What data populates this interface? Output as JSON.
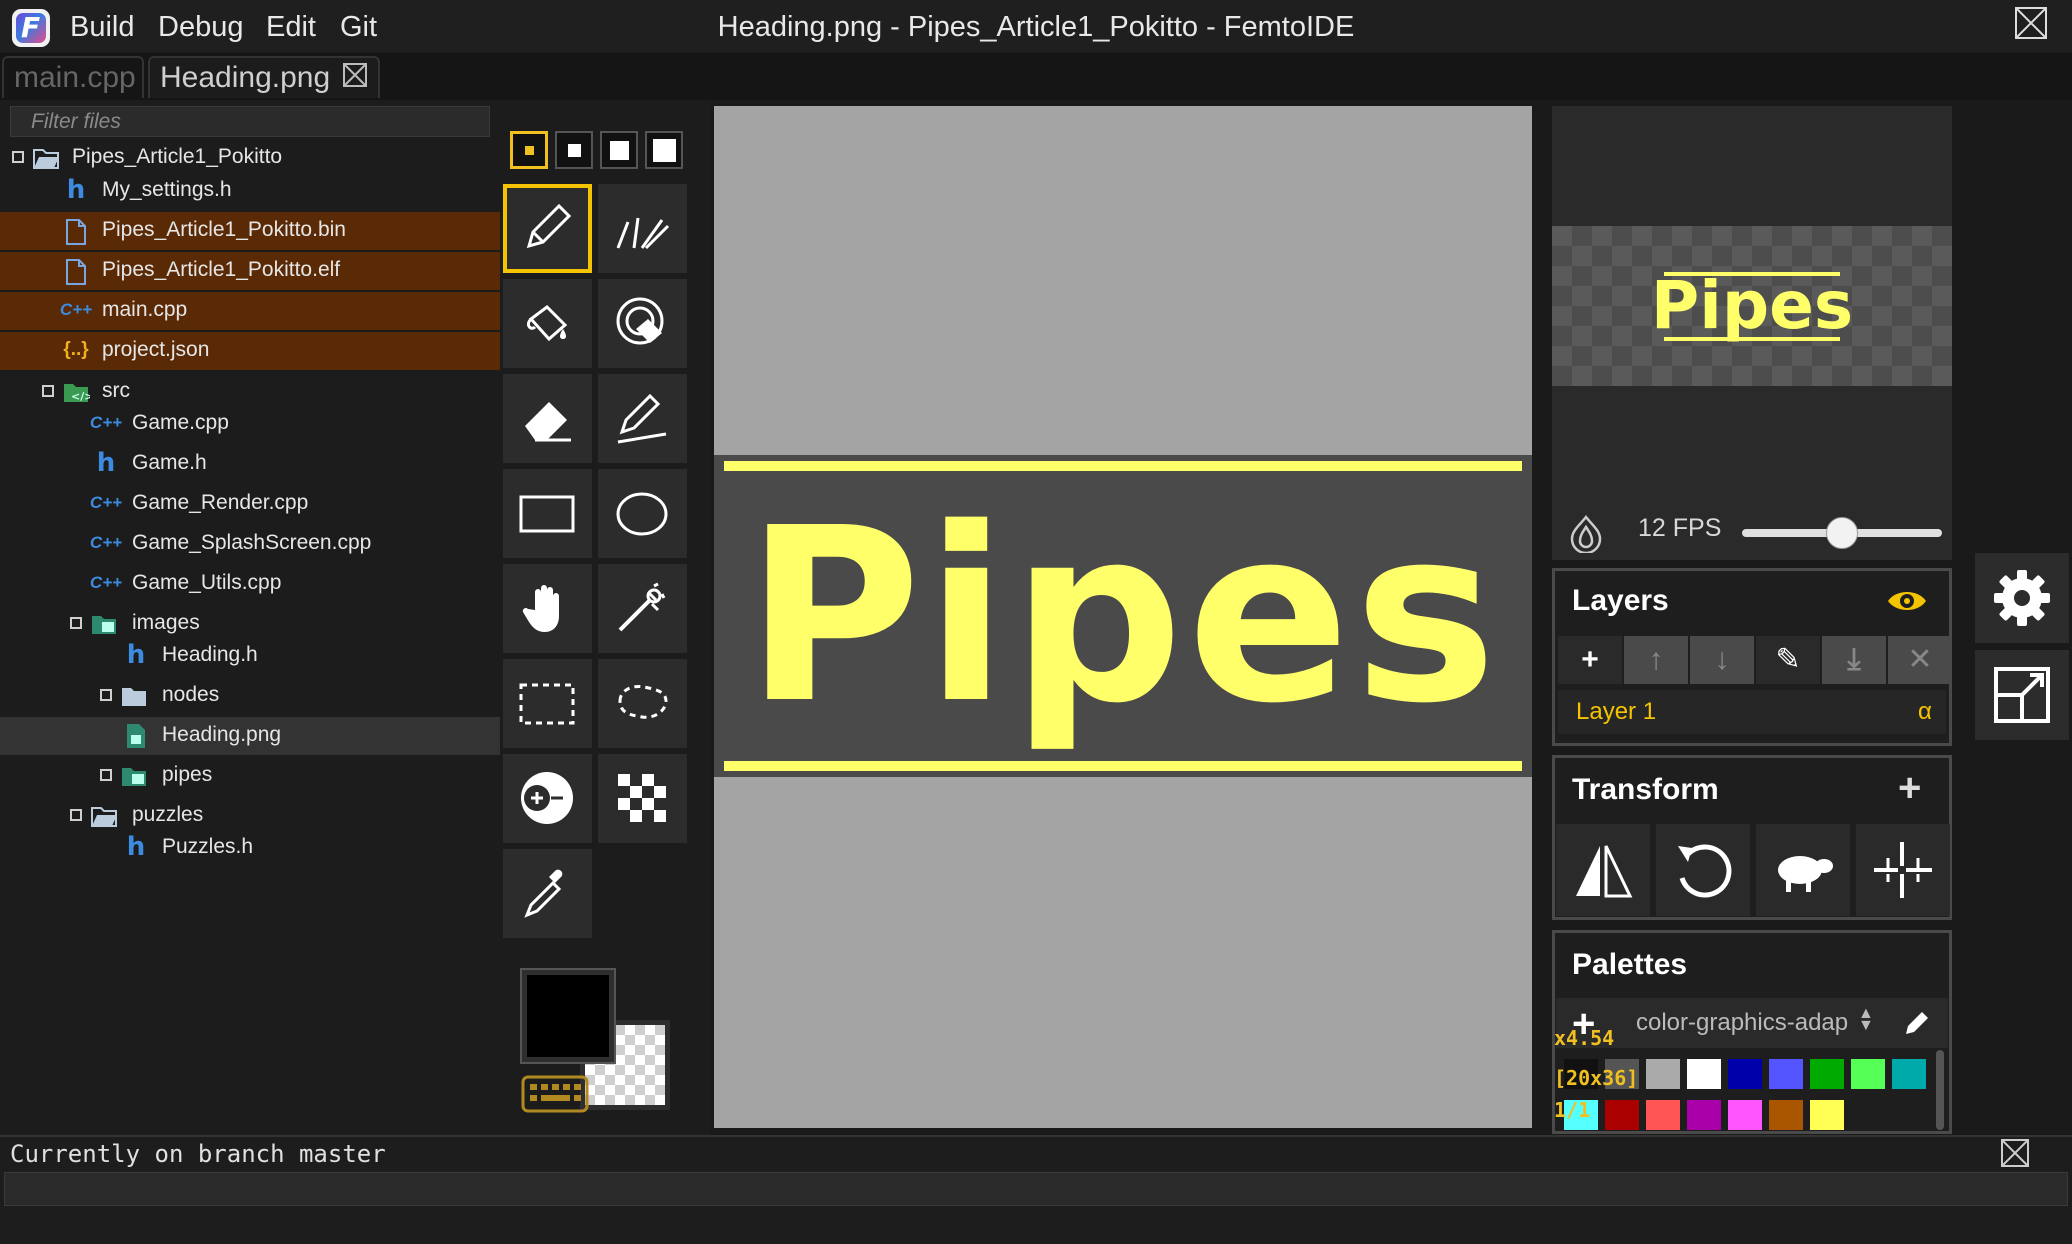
{
  "app": {
    "window_title": "Heading.png - Pipes_Article1_Pokitto - FemtoIDE",
    "menu": [
      "Build",
      "Debug",
      "Edit",
      "Git"
    ]
  },
  "tabs": [
    {
      "label": "main.cpp",
      "active": false
    },
    {
      "label": "Heading.png",
      "active": true
    }
  ],
  "filetree": {
    "filter_placeholder": "Filter files",
    "items": [
      {
        "label": "Pipes_Article1_Pokitto",
        "icon": "folder-open-icon"
      },
      {
        "label": "My_settings.h",
        "icon": "h-file-icon"
      },
      {
        "label": "Pipes_Article1_Pokitto.bin",
        "icon": "file-icon"
      },
      {
        "label": "Pipes_Article1_Pokitto.elf",
        "icon": "file-icon"
      },
      {
        "label": "main.cpp",
        "icon": "cpp-file-icon"
      },
      {
        "label": "project.json",
        "icon": "json-file-icon"
      },
      {
        "label": "src",
        "icon": "source-folder-icon"
      },
      {
        "label": "Game.cpp",
        "icon": "cpp-file-icon"
      },
      {
        "label": "Game.h",
        "icon": "h-file-icon"
      },
      {
        "label": "Game_Render.cpp",
        "icon": "cpp-file-icon"
      },
      {
        "label": "Game_SplashScreen.cpp",
        "icon": "cpp-file-icon"
      },
      {
        "label": "Game_Utils.cpp",
        "icon": "cpp-file-icon"
      },
      {
        "label": "images",
        "icon": "image-folder-icon"
      },
      {
        "label": "Heading.h",
        "icon": "h-file-icon"
      },
      {
        "label": "nodes",
        "icon": "folder-icon"
      },
      {
        "label": "Heading.png",
        "icon": "image-file-icon"
      },
      {
        "label": "pipes",
        "icon": "image-folder-icon"
      },
      {
        "label": "puzzles",
        "icon": "folder-open-icon"
      },
      {
        "label": "Puzzles.h",
        "icon": "h-file-icon"
      }
    ]
  },
  "icon_glyphs": {
    "h": "h",
    "cpp": "C++",
    "json": "{..}"
  },
  "canvas": {
    "image_text": "Pipes"
  },
  "preview": {
    "image_text": "Pipes",
    "fps_label": "12 FPS",
    "fps_slider_fraction": 0.5
  },
  "layers": {
    "title": "Layers",
    "layer_name": "Layer 1",
    "alpha_symbol": "α",
    "buttons": [
      "+",
      "↑",
      "↓",
      "✎",
      "⤓",
      "✕"
    ]
  },
  "transform": {
    "title": "Transform",
    "add": "+"
  },
  "palettes": {
    "title": "Palettes",
    "add": "+",
    "selected": "color-graphics-adap",
    "colors_row1": [
      "#111111",
      "#555555",
      "#aaaaaa",
      "#ffffff",
      "#0000aa",
      "#5555ff",
      "#00aa00",
      "#55ff55",
      "#00aaaa"
    ],
    "colors_row2": [
      "#55ffff",
      "#aa0000",
      "#ff5555",
      "#aa00aa",
      "#ff55ff",
      "#aa5500",
      "#ffff55"
    ]
  },
  "overlay": {
    "zoom": "x4.54",
    "size": "[20x36]",
    "index": "1/1"
  },
  "colors": {
    "accent": "#f5c400",
    "highlight_row": "#5a2a06",
    "image_yellow": "#ffff6a"
  },
  "status": {
    "text": "Currently on branch master"
  }
}
